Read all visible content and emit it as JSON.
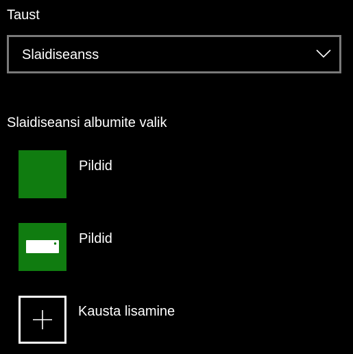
{
  "background": {
    "label": "Taust",
    "dropdown": {
      "selected": "Slaidiseanss",
      "icon": "chevron-down-icon"
    }
  },
  "albums": {
    "label": "Slaidiseansi albumite valik",
    "items": [
      {
        "name": "Pildid",
        "tile_color": "#107c10",
        "icon": "none"
      },
      {
        "name": "Pildid",
        "tile_color": "#107c10",
        "icon": "drive-icon"
      }
    ],
    "add_folder": {
      "label": "Kausta lisamine",
      "icon": "plus-icon"
    }
  },
  "colors": {
    "background": "#000000",
    "accent": "#107c10",
    "dropdown_border": "#7a7a7a",
    "text": "#ffffff"
  }
}
